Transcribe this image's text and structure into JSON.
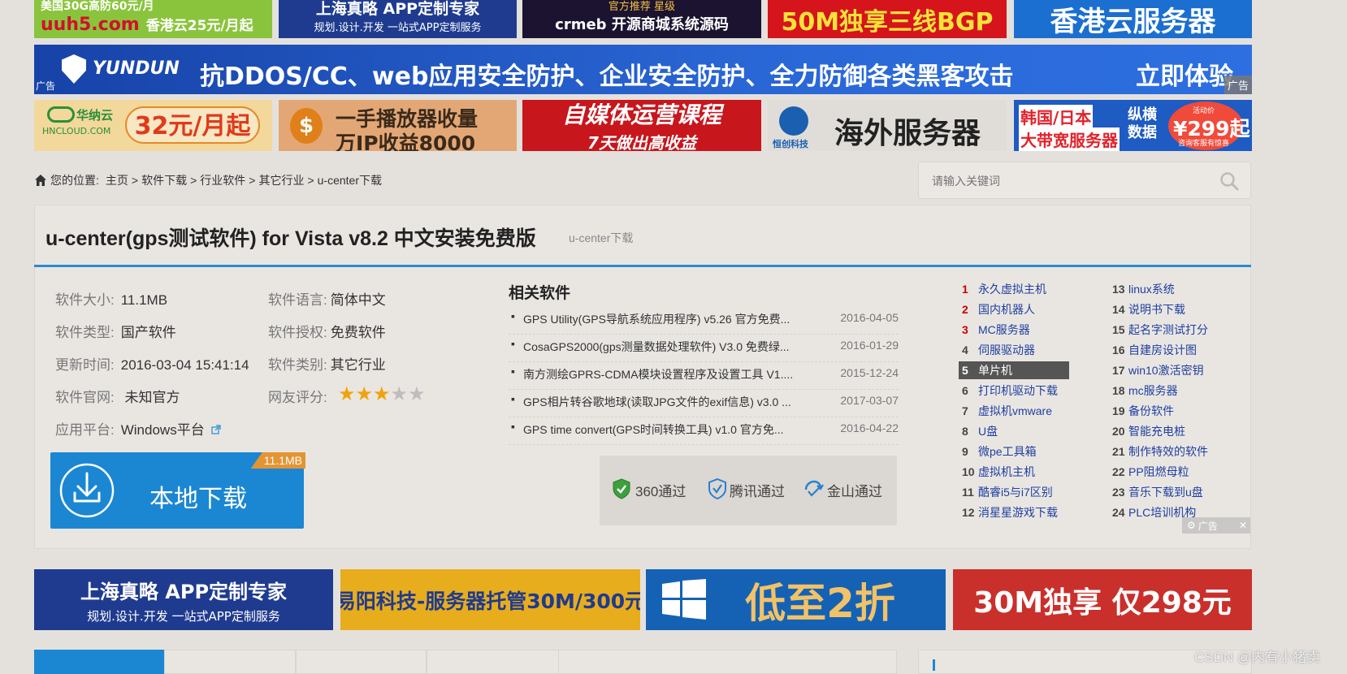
{
  "ads_row1": [
    {
      "text": "uuh5.com",
      "sub": "美国30G高防60元/月",
      "sub2": "香港云25元/月起"
    },
    {
      "text": "上海真略 APP定制专家",
      "sub": "规划.设计.开发 一站式APP定制服务"
    },
    {
      "text": "crmeb 开源商城系统源码",
      "sub": "官方推荐 星级"
    },
    {
      "text": "50M独享三线BGP"
    },
    {
      "text": "香港云服务器"
    }
  ],
  "ad_wide": {
    "brand": "YUNDUN",
    "text": "抗DDOS/CC、web应用安全防护、企业安全防护、全力防御各类黑客攻击",
    "cta": "立即体验",
    "tag_left": "广告",
    "tag_right": "广告"
  },
  "ads_row3": [
    {
      "brand": "华纳云",
      "brand_sub": "HNCLOUD.COM",
      "text": "32元/月起"
    },
    {
      "text": "一手播放器收量",
      "sub": "万IP收益8000"
    },
    {
      "text": "自媒体运营课程",
      "sub": "7天做出高收益"
    },
    {
      "brand": "恒创科技",
      "text": "海外服务器"
    },
    {
      "text": "韩国/日本",
      "sub": "大带宽服务器",
      "side": "纵横数据",
      "badge": "¥299起",
      "badge_top": "活动价",
      "badge_sub": "咨询客服有惊喜"
    }
  ],
  "breadcrumb": {
    "prefix": "您的位置:",
    "items": [
      "主页",
      "软件下载",
      "行业软件",
      "其它行业",
      "u-center下载"
    ],
    "sep": ">"
  },
  "search": {
    "placeholder": "请输入关键词"
  },
  "software": {
    "title": "u-center(gps测试软件) for Vista v8.2 中文安装免费版",
    "subtitle": "u-center下载",
    "info": [
      {
        "k": "软件大小:",
        "v": "11.1MB"
      },
      {
        "k": "软件语言:",
        "v": "简体中文"
      },
      {
        "k": "软件类型:",
        "v": "国产软件"
      },
      {
        "k": "软件授权:",
        "v": "免费软件"
      },
      {
        "k": "更新时间:",
        "v": "2016-03-04 15:41:14"
      },
      {
        "k": "软件类别:",
        "v": "其它行业"
      },
      {
        "k": "软件官网:",
        "v": " 未知官方"
      },
      {
        "k": "网友评分:",
        "v": ""
      },
      {
        "k": "应用平台:",
        "v": "Windows平台"
      }
    ],
    "rating": 3,
    "rating_max": 5,
    "download_label": "本地下载",
    "download_size": "11.1MB"
  },
  "related": {
    "title": "相关软件",
    "items": [
      {
        "t": "GPS Utility(GPS导航系统应用程序) v5.26 官方免费...",
        "d": "2016-04-05"
      },
      {
        "t": "CosaGPS2000(gps测量数据处理软件) V3.0 免费绿...",
        "d": "2016-01-29"
      },
      {
        "t": "南方测绘GPRS-CDMA模块设置程序及设置工具 V1....",
        "d": "2015-12-24"
      },
      {
        "t": "GPS相片转谷歌地球(读取JPG文件的exif信息) v3.0 ...",
        "d": "2017-03-07"
      },
      {
        "t": "GPS time convert(GPS时间转换工具) v1.0 官方免...",
        "d": "2016-04-22"
      }
    ]
  },
  "verify": {
    "v360": "360通过",
    "tencent": "腾讯通过",
    "kingsoft": "金山通过"
  },
  "hot_left": [
    {
      "n": "1",
      "l": "永久虚拟主机"
    },
    {
      "n": "2",
      "l": "国内机器人"
    },
    {
      "n": "3",
      "l": "MC服务器"
    },
    {
      "n": "4",
      "l": "伺服驱动器"
    },
    {
      "n": "5",
      "l": "单片机"
    },
    {
      "n": "6",
      "l": "打印机驱动下载"
    },
    {
      "n": "7",
      "l": "虚拟机vmware"
    },
    {
      "n": "8",
      "l": "U盘"
    },
    {
      "n": "9",
      "l": "微pe工具箱"
    },
    {
      "n": "10",
      "l": "虚拟机主机"
    },
    {
      "n": "11",
      "l": "酷睿i5与i7区别"
    },
    {
      "n": "12",
      "l": "消星星游戏下载"
    }
  ],
  "hot_right": [
    {
      "n": "13",
      "l": "linux系统"
    },
    {
      "n": "14",
      "l": "说明书下载"
    },
    {
      "n": "15",
      "l": "起名字测试打分"
    },
    {
      "n": "16",
      "l": "自建房设计图"
    },
    {
      "n": "17",
      "l": "win10激活密钥"
    },
    {
      "n": "18",
      "l": "mc服务器"
    },
    {
      "n": "19",
      "l": "备份软件"
    },
    {
      "n": "20",
      "l": "智能充电桩"
    },
    {
      "n": "21",
      "l": "制作特效的软件"
    },
    {
      "n": "22",
      "l": "PP阻燃母粒"
    },
    {
      "n": "23",
      "l": "音乐下载到u盘"
    },
    {
      "n": "24",
      "l": "PLC培训机构"
    }
  ],
  "hot_ad_tag": "广告",
  "ads_bottom": [
    {
      "text": "上海真略 APP定制专家",
      "sub": "规划.设计.开发 一站式APP定制服务"
    },
    {
      "text": "易阳科技-服务器托管30M/300元"
    },
    {
      "text": "低至2折"
    },
    {
      "text": "30M独享 仅298元"
    }
  ],
  "watermark": "CSDN @内有小猪卖",
  "colors": {
    "accent": "#1b87d2",
    "title_line": "#2a8bd0",
    "star_on": "#f0a30a",
    "star_off": "#bdbdbd"
  }
}
